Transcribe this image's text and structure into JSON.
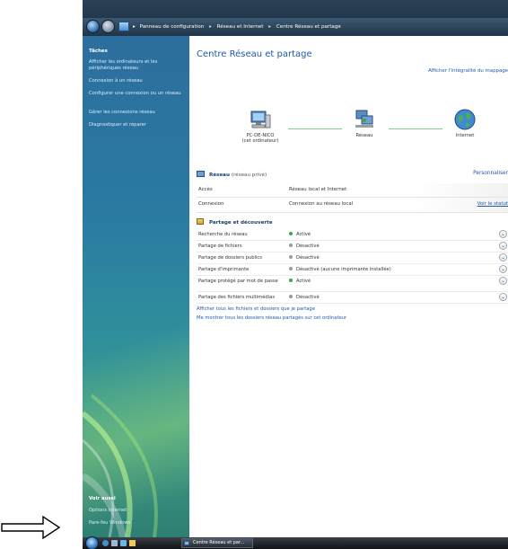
{
  "breadcrumb": {
    "items": [
      "Panneau de configuration",
      "Réseau et Internet",
      "Centre Réseau et partage"
    ],
    "separator": "▸"
  },
  "sidebar": {
    "tasks_title": "Tâches",
    "tasks": [
      "Afficher les ordinateurs et les périphériques réseau",
      "Connexion à un réseau",
      "Configurer une connexion ou un réseau",
      "Gérer les connexions réseau",
      "Diagnostiquer et réparer"
    ],
    "see_also_title": "Voir aussi",
    "see_also": [
      "Options Internet",
      "Pare-feu Windows"
    ]
  },
  "main": {
    "title": "Centre Réseau et partage",
    "map_link": "Afficher l'intégralité du mappage",
    "nodes": [
      {
        "label": "PC-DE-NICO",
        "sublabel": "(cet ordinateur)"
      },
      {
        "label": "Réseau"
      },
      {
        "label": "Internet"
      }
    ],
    "network": {
      "name": "Réseau",
      "type": "(réseau privé)",
      "customize": "Personnaliser",
      "rows": [
        {
          "key": "Accès",
          "value": "Réseau local et Internet",
          "link": ""
        },
        {
          "key": "Connexion",
          "value": "Connexion au réseau local",
          "link": "Voir le statut"
        }
      ]
    },
    "sharing": {
      "title": "Partage et découverte",
      "rows": [
        {
          "key": "Recherche du réseau",
          "value": "Activé",
          "on": true
        },
        {
          "key": "Partage de fichiers",
          "value": "Désactivé",
          "on": false
        },
        {
          "key": "Partage de dossiers publics",
          "value": "Désactivé",
          "on": false
        },
        {
          "key": "Partage d'imprimante",
          "value": "Désactivé (aucune imprimante installée)",
          "on": false
        },
        {
          "key": "Partage protégé par mot de passe",
          "value": "Activé",
          "on": true
        },
        {
          "key": "Partage des fichiers multimédias",
          "value": "Désactivé",
          "on": false
        }
      ]
    },
    "bottom_links": [
      "Afficher tous les fichiers et dossiers que je partage",
      "Me montrer tous les dossiers réseau partagés sur cet ordinateur"
    ]
  },
  "taskbar": {
    "task_label": "Centre Réseau et par..."
  },
  "colors": {
    "link": "#1e5aa8",
    "on": "#3aaa36",
    "off": "#9a9a9a"
  }
}
